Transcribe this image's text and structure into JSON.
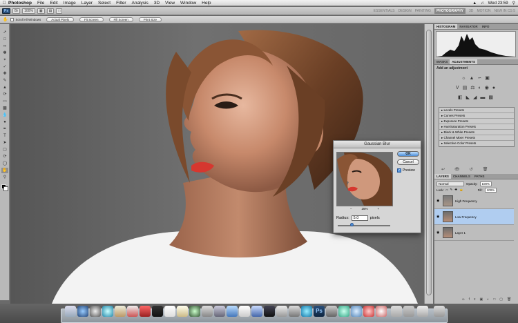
{
  "menubar": {
    "app_name": "Photoshop",
    "menus": [
      "File",
      "Edit",
      "Image",
      "Layer",
      "Select",
      "Filter",
      "Analysis",
      "3D",
      "View",
      "Window",
      "Help"
    ],
    "clock": "Wed 23:59"
  },
  "appbar": {
    "zoom": "100%",
    "workspaces": [
      "ESSENTIALS",
      "DESIGN",
      "PAINTING",
      "PHOTOGRAPHY",
      "3D",
      "MOTION"
    ],
    "active_workspace": "PHOTOGRAPHY",
    "search_label": "NEW IN CS 5"
  },
  "options": {
    "scroll_all_windows": "Scroll All Windows",
    "actual_pixels": "Actual Pixels",
    "fit_screen": "Fit Screen",
    "fill_screen": "Fill Screen",
    "print_size": "Print Size"
  },
  "panels": {
    "histogram_tabs": [
      "HISTOGRAM",
      "NAVIGATOR",
      "INFO"
    ],
    "adjust_tabs": [
      "MASKS",
      "ADJUSTMENTS"
    ],
    "add_adjustment": "Add an adjustment",
    "presets": [
      "Levels Presets",
      "Curves Presets",
      "Exposure Presets",
      "Hue/Saturation Presets",
      "Black & White Presets",
      "Channel Mixer Presets",
      "Selective Color Presets"
    ],
    "layer_tabs": [
      "LAYERS",
      "CHANNELS",
      "PATHS"
    ],
    "blend_mode": "Normal",
    "opacity_label": "Opacity:",
    "opacity": "100%",
    "lock_label": "Lock:",
    "fill_label": "Fill:",
    "fill": "100%",
    "layers": [
      {
        "name": "High Frequency"
      },
      {
        "name": "Low Frequency"
      },
      {
        "name": "Layer 1"
      }
    ]
  },
  "dialog": {
    "title": "Gaussian Blur",
    "ok": "OK",
    "cancel": "Cancel",
    "preview_label": "Preview",
    "zoom_value": "25%",
    "zoom_minus": "−",
    "zoom_plus": "+",
    "radius_label": "Radius:",
    "radius_value": "5.0",
    "radius_unit": "pixels"
  },
  "colors": {
    "accent": "#4e8ed8",
    "selected_layer": "#b0cdf0"
  }
}
